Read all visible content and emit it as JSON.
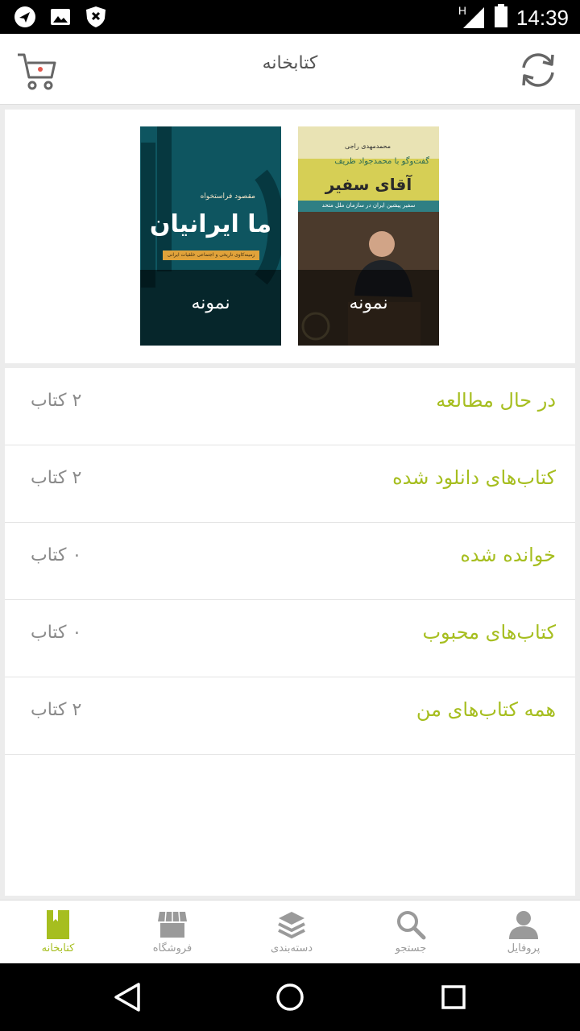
{
  "status_bar": {
    "time": "14:39",
    "network_label": "H",
    "icons": [
      "navigation-icon",
      "image-icon",
      "shield-icon",
      "signal-icon",
      "battery-icon"
    ]
  },
  "app_bar": {
    "title": "کتابخانه",
    "cart_icon": "cart-icon",
    "refresh_icon": "refresh-icon"
  },
  "books": [
    {
      "author": "مقصود فراستخواه",
      "title": "ما ایرانیان",
      "subtitle": "زمینه‌کاوی تاریخی و اجتماعی خلقیات ایرانی",
      "badge": "نمونه"
    },
    {
      "author": "محمدمهدی راجی",
      "tagline": "گفت‌وگو با محمدجواد ظریف",
      "title": "آقای سفیر",
      "subtitle": "سفیر پیشین ایران در سازمان ملل متحد",
      "badge": "نمونه"
    }
  ],
  "library_rows": [
    {
      "label": "در حال مطالعه",
      "count": "۲ کتاب"
    },
    {
      "label": "کتاب‌های دانلود شده",
      "count": "۲ کتاب"
    },
    {
      "label": "خوانده شده",
      "count": "۰ کتاب"
    },
    {
      "label": "کتاب‌های محبوب",
      "count": "۰ کتاب"
    },
    {
      "label": "همه کتاب‌های من",
      "count": "۲ کتاب"
    }
  ],
  "bottom_nav": [
    {
      "label": "کتابخانه",
      "icon": "book-icon",
      "active": true
    },
    {
      "label": "فروشگاه",
      "icon": "store-icon",
      "active": false
    },
    {
      "label": "دسته‌بندی",
      "icon": "layers-icon",
      "active": false
    },
    {
      "label": "جستجو",
      "icon": "search-icon",
      "active": false
    },
    {
      "label": "پروفایل",
      "icon": "profile-icon",
      "active": false
    }
  ],
  "colors": {
    "accent": "#a6be1f",
    "muted_text": "#8a8a8a",
    "title_text": "#555555"
  }
}
